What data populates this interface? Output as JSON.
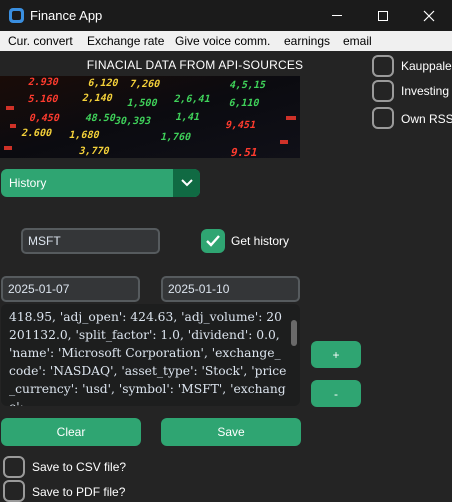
{
  "window": {
    "title": "Finance App"
  },
  "menu": [
    "Cur. convert",
    "Exchange rate",
    "Give voice comm.",
    "earnings",
    "email"
  ],
  "header": "FINACIAL DATA FROM API-SOURCES",
  "ticker": {
    "values": [
      "2.930",
      "6,120",
      "5.160",
      "2,140",
      "0,450",
      "2.600",
      "1,680",
      "3,770",
      "7,260",
      "1,500",
      "48.50",
      "30,393",
      "2,6,41",
      "1,41",
      "1,760",
      "4,5,15",
      "6,110",
      "9,451",
      "9.51"
    ]
  },
  "side_options": [
    "Kauppalehti",
    "Investing",
    "Own RSS"
  ],
  "mode_select": {
    "value": "History"
  },
  "symbol_input": {
    "value": "MSFT"
  },
  "get_history": {
    "label": "Get history",
    "checked": true
  },
  "start_date": "2025-01-07",
  "end_date": "2025-01-10",
  "output_text": "418.95, 'adj_open': 424.63, 'adj_volume': 20201132.0, 'split_factor': 1.0, 'dividend': 0.0, 'name': 'Microsoft Corporation', 'exchange_code': 'NASDAQ', 'asset_type': 'Stock', 'price_currency': 'usd', 'symbol': 'MSFT', 'exchange':",
  "buttons": {
    "plus": "+",
    "minus": "-",
    "clear": "Clear",
    "save": "Save"
  },
  "save_options": [
    "Save to CSV file?",
    "Save to PDF file?"
  ],
  "colors": {
    "accent": "#2fa572",
    "accent_dark": "#106a43",
    "background": "#242424"
  }
}
